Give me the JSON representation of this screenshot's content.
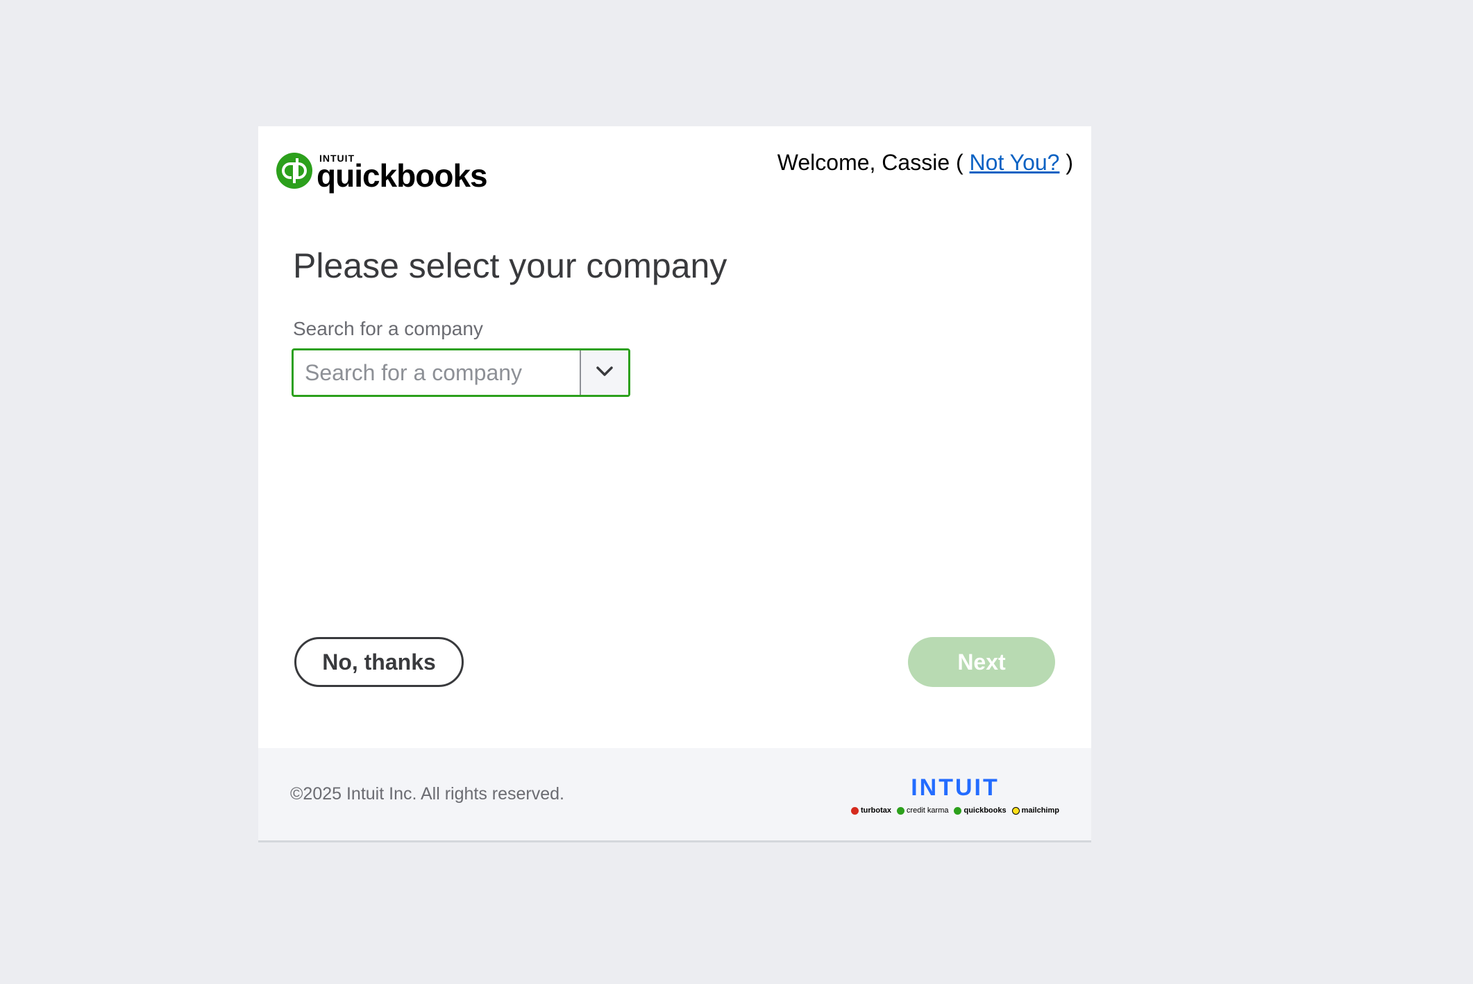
{
  "header": {
    "logo_small": "INTUIT",
    "logo_main": "quickbooks",
    "welcome_prefix": "Welcome, Cassie ( ",
    "not_you_link": "Not You?",
    "welcome_suffix": " )"
  },
  "main": {
    "title": "Please select your company",
    "search_label": "Search for a company",
    "search_placeholder": "Search for a company",
    "search_value": ""
  },
  "actions": {
    "secondary_label": "No, thanks",
    "primary_label": "Next"
  },
  "footer": {
    "copyright": "©2025 Intuit Inc. All rights reserved.",
    "brand_name": "INTUIT",
    "brands": [
      {
        "label": "turbotax",
        "color": "#D52B1E"
      },
      {
        "label": "credit karma",
        "color": "#2CA01C"
      },
      {
        "label": "quickbooks",
        "color": "#2CA01C"
      },
      {
        "label": "mailchimp",
        "color": "#FFE01B"
      }
    ]
  },
  "colors": {
    "background": "#ECEDF1",
    "accent_green": "#2CA01C",
    "link_blue": "#0B62C3",
    "intuit_blue": "#236CFF",
    "disabled_button": "#B8DAB2"
  },
  "icons": {
    "logo": "quickbooks-logo-icon",
    "dropdown": "chevron-down-icon"
  }
}
